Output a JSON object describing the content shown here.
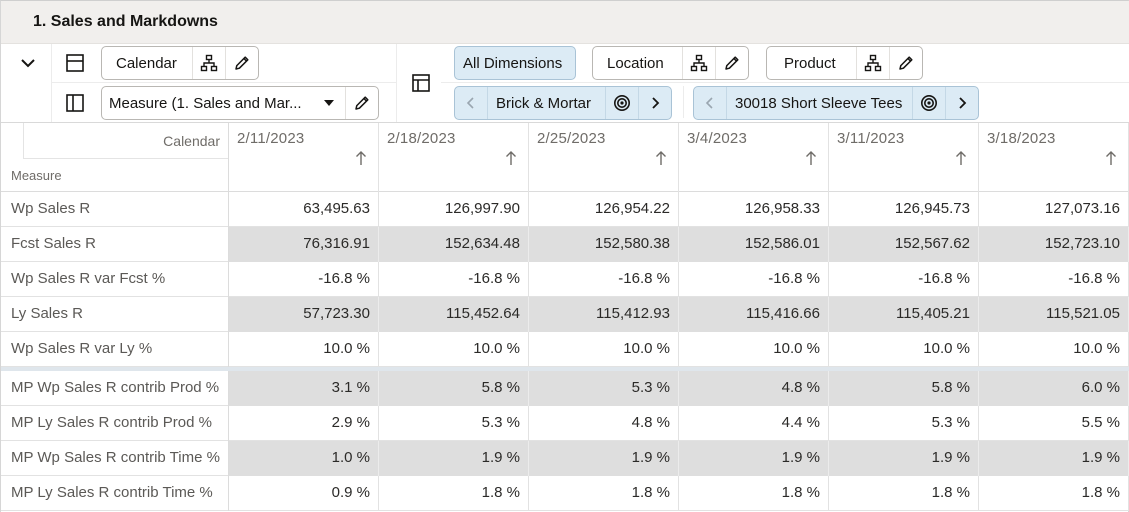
{
  "header": {
    "title": "1. Sales and Markdowns"
  },
  "toolbar": {
    "collapse_icon": "chevron-down-icon",
    "row_layout_icon": "layout-rows-icon",
    "column_layout_icon": "layout-columns-icon",
    "pivot_icon": "pivot-layout-icon",
    "calendar": {
      "label": "Calendar",
      "hierarchy_icon": "hierarchy-icon",
      "edit_icon": "pencil-icon"
    },
    "measure": {
      "label": "Measure (1. Sales and Mar...",
      "dropdown_icon": "caret-down-icon",
      "edit_icon": "pencil-icon"
    },
    "all_dimensions": {
      "label": "All Dimensions"
    },
    "location": {
      "label": "Location",
      "hierarchy_icon": "hierarchy-icon",
      "edit_icon": "pencil-icon"
    },
    "product": {
      "label": "Product",
      "hierarchy_icon": "hierarchy-icon",
      "edit_icon": "pencil-icon"
    },
    "location_selector": {
      "value": "Brick & Mortar",
      "prev_icon": "chevron-left-icon",
      "target_icon": "target-icon",
      "next_icon": "chevron-right-icon"
    },
    "product_selector": {
      "value": "30018 Short Sleeve Tees",
      "prev_icon": "chevron-left-icon",
      "target_icon": "target-icon",
      "next_icon": "chevron-right-icon"
    }
  },
  "grid": {
    "column_dimension_label": "Calendar",
    "row_dimension_label": "Measure",
    "columns": [
      "2/11/2023",
      "2/18/2023",
      "2/25/2023",
      "3/4/2023",
      "3/11/2023",
      "3/18/2023"
    ],
    "rows": [
      {
        "label": "Wp Sales R",
        "values": [
          "63,495.63",
          "126,997.90",
          "126,954.22",
          "126,958.33",
          "126,945.73",
          "127,073.16"
        ]
      },
      {
        "label": "Fcst Sales R",
        "values": [
          "76,316.91",
          "152,634.48",
          "152,580.38",
          "152,586.01",
          "152,567.62",
          "152,723.10"
        ]
      },
      {
        "label": "Wp Sales R var Fcst %",
        "values": [
          "-16.8 %",
          "-16.8 %",
          "-16.8 %",
          "-16.8 %",
          "-16.8 %",
          "-16.8 %"
        ]
      },
      {
        "label": "Ly Sales R",
        "values": [
          "57,723.30",
          "115,452.64",
          "115,412.93",
          "115,416.66",
          "115,405.21",
          "115,521.05"
        ]
      },
      {
        "label": "Wp Sales R var Ly %",
        "values": [
          "10.0 %",
          "10.0 %",
          "10.0 %",
          "10.0 %",
          "10.0 %",
          "10.0 %"
        ]
      },
      {
        "label": "MP Wp Sales R contrib Prod %",
        "values": [
          "3.1 %",
          "5.8 %",
          "5.3 %",
          "4.8 %",
          "5.8 %",
          "6.0 %"
        ]
      },
      {
        "label": "MP Ly Sales R contrib Prod %",
        "values": [
          "2.9 %",
          "5.3 %",
          "4.8 %",
          "4.4 %",
          "5.3 %",
          "5.5 %"
        ]
      },
      {
        "label": "MP Wp Sales R contrib Time %",
        "values": [
          "1.0 %",
          "1.9 %",
          "1.9 %",
          "1.9 %",
          "1.9 %",
          "1.9 %"
        ]
      },
      {
        "label": "MP Ly Sales R contrib Time %",
        "values": [
          "0.9 %",
          "1.8 %",
          "1.8 %",
          "1.8 %",
          "1.8 %",
          "1.8 %"
        ]
      }
    ]
  }
}
